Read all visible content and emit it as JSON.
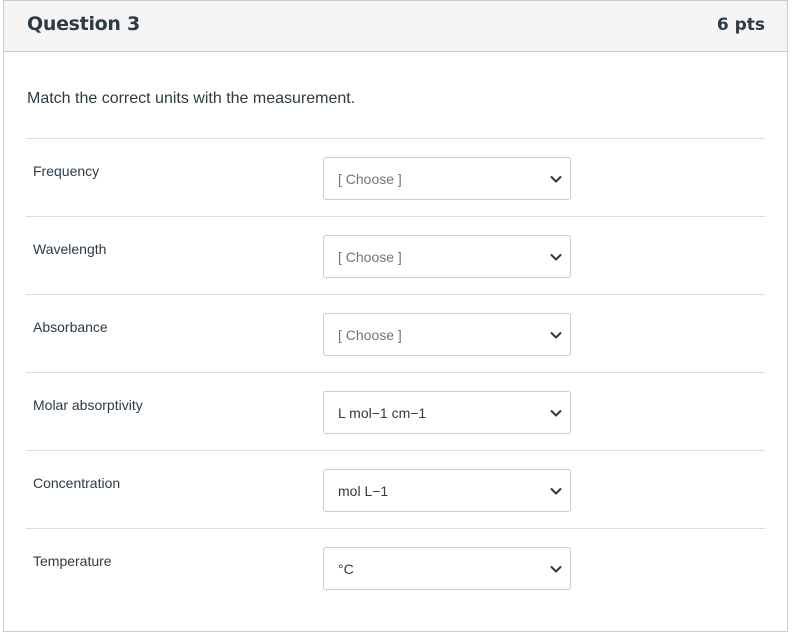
{
  "question": {
    "title": "Question 3",
    "points": "6 pts",
    "prompt": "Match the correct units with the measurement."
  },
  "matches": [
    {
      "label": "Frequency",
      "selected": "[ Choose ]",
      "is_placeholder": true
    },
    {
      "label": "Wavelength",
      "selected": "[ Choose ]",
      "is_placeholder": true
    },
    {
      "label": "Absorbance",
      "selected": "[ Choose ]",
      "is_placeholder": true
    },
    {
      "label": "Molar absorptivity",
      "selected": "L mol−1 cm−1",
      "is_placeholder": false
    },
    {
      "label": "Concentration",
      "selected": "mol L−1",
      "is_placeholder": false
    },
    {
      "label": "Temperature",
      "selected": "°C",
      "is_placeholder": false
    }
  ],
  "colors": {
    "header_bg": "#f5f5f5",
    "border": "#c7cdd1",
    "text": "#2d3b45",
    "placeholder_text": "#6b7780"
  },
  "icons": {
    "dropdown": "chevron-down-icon"
  }
}
